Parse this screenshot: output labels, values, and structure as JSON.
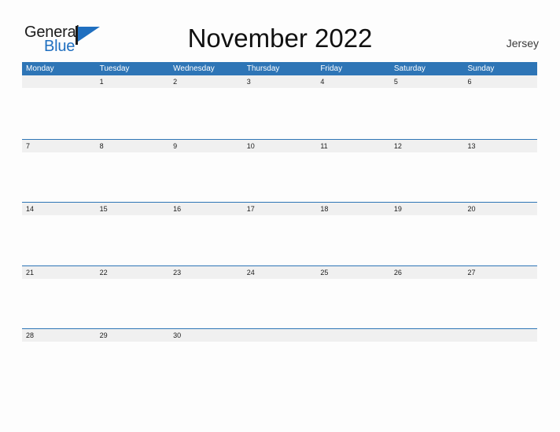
{
  "brand": {
    "name_part1": "General",
    "name_part2": "Blue",
    "flag_icon": "blue-flag-triangle-icon",
    "color_primary": "#1f6fc0",
    "color_text": "#1a1a1a"
  },
  "header": {
    "title": "November 2022",
    "locale": "Jersey"
  },
  "calendar": {
    "header_bg": "#2e75b6",
    "row_line_color": "#2e75b6",
    "day_strip_bg": "#f0f0f0",
    "weekdays": [
      "Monday",
      "Tuesday",
      "Wednesday",
      "Thursday",
      "Friday",
      "Saturday",
      "Sunday"
    ],
    "weeks": [
      [
        "",
        "1",
        "2",
        "3",
        "4",
        "5",
        "6"
      ],
      [
        "7",
        "8",
        "9",
        "10",
        "11",
        "12",
        "13"
      ],
      [
        "14",
        "15",
        "16",
        "17",
        "18",
        "19",
        "20"
      ],
      [
        "21",
        "22",
        "23",
        "24",
        "25",
        "26",
        "27"
      ],
      [
        "28",
        "29",
        "30",
        "",
        "",
        "",
        ""
      ]
    ]
  }
}
